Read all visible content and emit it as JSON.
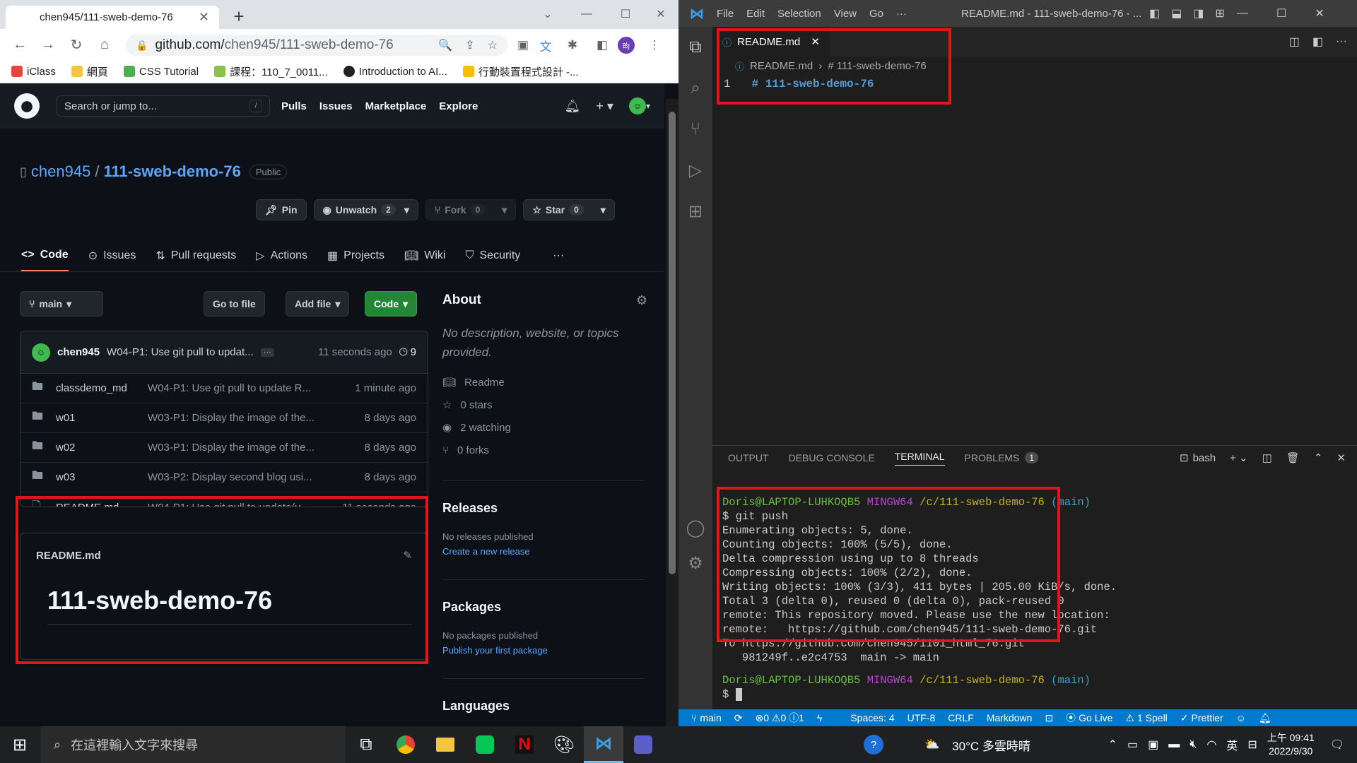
{
  "chrome": {
    "tab_title": "chen945/111-sweb-demo-76",
    "url_host": "github.com/",
    "url_path": "chen945/111-sweb-demo-76",
    "bookmarks": [
      "iClass",
      "網頁",
      "CSS Tutorial",
      "課程：110_7_0011...",
      "Introduction to AI...",
      "行動裝置程式設計 -..."
    ]
  },
  "github": {
    "search_placeholder": "Search or jump to...",
    "search_key": "/",
    "nav": [
      "Pulls",
      "Issues",
      "Marketplace",
      "Explore"
    ],
    "owner": "chen945",
    "repo": "111-sweb-demo-76",
    "visibility": "Public",
    "pin": "Pin",
    "unwatch": "Unwatch",
    "unwatch_count": "2",
    "fork": "Fork",
    "fork_count": "0",
    "star": "Star",
    "star_count": "0",
    "tabs": [
      "Code",
      "Issues",
      "Pull requests",
      "Actions",
      "Projects",
      "Wiki",
      "Security"
    ],
    "branch": "main",
    "go_to_file": "Go to file",
    "add_file": "Add file",
    "code_button": "Code",
    "commit": {
      "author": "chen945",
      "message": "W04-P1: Use git pull to updat...",
      "time": "11 seconds ago",
      "count": "9"
    },
    "files": [
      {
        "name": "classdemo_md",
        "msg": "W04-P1: Use git pull to update R...",
        "time": "1 minute ago",
        "type": "folder"
      },
      {
        "name": "w01",
        "msg": "W03-P1: Display the image of the...",
        "time": "8 days ago",
        "type": "folder"
      },
      {
        "name": "w02",
        "msg": "W03-P1: Display the image of the...",
        "time": "8 days ago",
        "type": "folder"
      },
      {
        "name": "w03",
        "msg": "W03-P2: Display second blog usi...",
        "time": "8 days ago",
        "type": "folder"
      },
      {
        "name": "README.md",
        "msg": "W04-P1: Use git pull to update(v...",
        "time": "11 seconds ago",
        "type": "file"
      }
    ],
    "readme_label": "README.md",
    "readme_heading": "111-sweb-demo-76",
    "about": {
      "title": "About",
      "desc": "No description, website, or topics provided.",
      "items": [
        "Readme",
        "0 stars",
        "2 watching",
        "0 forks"
      ]
    },
    "releases": {
      "title": "Releases",
      "none": "No releases published",
      "link": "Create a new release"
    },
    "packages": {
      "title": "Packages",
      "none": "No packages published",
      "link": "Publish your first package"
    },
    "languages": {
      "title": "Languages"
    }
  },
  "vscode": {
    "menu": [
      "File",
      "Edit",
      "Selection",
      "View",
      "Go",
      "···"
    ],
    "window_title": "README.md - 111-sweb-demo-76 - ...",
    "tab": "README.md",
    "breadcrumb_file": "README.md",
    "breadcrumb_symbol": "# 111-sweb-demo-76",
    "line_number": "1",
    "line_code": "# 111-sweb-demo-76",
    "panel_tabs": [
      "OUTPUT",
      "DEBUG CONSOLE",
      "TERMINAL",
      "PROBLEMS"
    ],
    "problems_count": "1",
    "shell": "bash",
    "prompt_user": "Doris@LAPTOP-LUHKOQB5",
    "prompt_env": "MINGW64",
    "prompt_path": "/c/111-sweb-demo-76",
    "prompt_branch": "(main)",
    "terminal_lines": [
      "$ git push",
      "Enumerating objects: 5, done.",
      "Counting objects: 100% (5/5), done.",
      "Delta compression using up to 8 threads",
      "Compressing objects: 100% (2/2), done.",
      "Writing objects: 100% (3/3), 411 bytes | 205.00 KiB/s, done.",
      "Total 3 (delta 0), reused 0 (delta 0), pack-reused 0",
      "remote: This repository moved. Please use the new location:",
      "remote:   https://github.com/chen945/111-sweb-demo-76.git",
      "To https://github.com/chen945/1101_html_76.git",
      "   981249f..e2c4753  main -> main"
    ],
    "last_prompt": "$",
    "status": {
      "branch": "main",
      "problems": "⊗0 ⚠0 ⓘ1",
      "spaces": "Spaces: 4",
      "encoding": "UTF-8",
      "eol": "CRLF",
      "language": "Markdown",
      "golive": "Go Live",
      "spell": "1 Spell",
      "prettier": "Prettier"
    }
  },
  "taskbar": {
    "search_placeholder": "在這裡輸入文字來搜尋",
    "weather": "30°C 多雲時晴",
    "ime": "英",
    "time": "上午 09:41",
    "date": "2022/9/30"
  }
}
